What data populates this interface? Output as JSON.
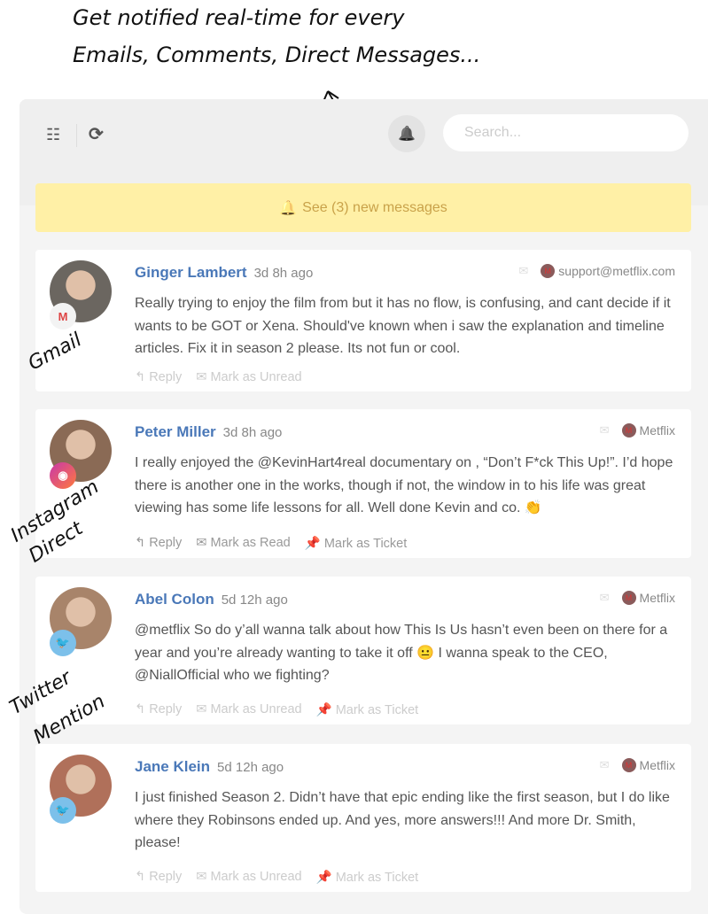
{
  "annotations": {
    "top_line1": "Get notified real-time for every",
    "top_line2": "Emails, Comments, Direct Messages...",
    "gmail": "Gmail",
    "instagram1": "Instagram",
    "instagram2": "Direct",
    "twitter1": "Twitter",
    "twitter2": "Mention"
  },
  "toolbar": {
    "tasks_icon": "☷",
    "refresh_icon": "⟳",
    "bell_icon": "🔔",
    "search_placeholder": "Search..."
  },
  "banner": {
    "icon": "🔔",
    "text": "See (3) new messages"
  },
  "colors": {
    "accent": "#4a78b8",
    "banner": "#fff0a6",
    "banner_text": "#c9a24a"
  },
  "messages": [
    {
      "name": "Ginger Lambert",
      "time": "3d 8h ago",
      "account": "support@metflix.com",
      "source": "gmail",
      "text": "Really trying to enjoy the film from but it has no flow, is confusing, and cant decide if it wants to be GOT or Xena. Should've known when i saw the explanation and timeline articles. Fix it in season 2 please. Its not fun or cool.",
      "actions": [
        "Reply",
        "Mark as Unread"
      ],
      "avatar": "#6b6660"
    },
    {
      "name": "Peter Miller",
      "time": "3d 8h ago",
      "account": "Metflix",
      "source": "instagram",
      "text": "I really enjoyed the @KevinHart4real documentary on , “Don’t F*ck This Up!”. I’d hope there is another one in the works, though if not, the window in to his life was great viewing has some life lessons for all. Well done Kevin and co. 👏",
      "actions": [
        "Reply",
        "Mark as Read",
        "Mark as Ticket"
      ],
      "avatar": "#8a6a55"
    },
    {
      "name": "Abel Colon",
      "time": "5d 12h ago",
      "account": "Metflix",
      "source": "twitter",
      "text": "@metflix So do y’all wanna talk about how This Is Us hasn’t even been on there for a year and you’re already wanting to take it off 😐 I wanna speak to the CEO, @NiallOfficial who we fighting?",
      "actions": [
        "Reply",
        "Mark as Unread",
        "Mark as Ticket"
      ],
      "avatar": "#a8846a"
    },
    {
      "name": "Jane Klein",
      "time": "5d 12h ago",
      "account": "Metflix",
      "source": "twitter",
      "text": "I just finished Season 2. Didn’t have that epic ending like the first season, but I do like where they Robinsons ended up. And yes, more answers!!! And more Dr. Smith, please!",
      "actions": [
        "Reply",
        "Mark as Unread",
        "Mark as Ticket"
      ],
      "avatar": "#b0705a"
    }
  ]
}
